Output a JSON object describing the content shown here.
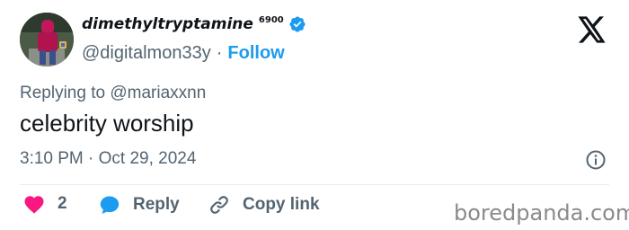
{
  "header": {
    "display_name": "dimethyltryptamine",
    "name_badge": "6900",
    "handle": "@digitalmon33y",
    "separator": "·",
    "follow_label": "Follow"
  },
  "reply_context": {
    "prefix": "Replying to",
    "mention": "@mariaxxnn"
  },
  "tweet": {
    "text": "celebrity worship",
    "timestamp": "3:10 PM · Oct 29, 2024"
  },
  "actions": {
    "like_count": "2",
    "reply_label": "Reply",
    "copy_link_label": "Copy link"
  },
  "watermark": "boredpanda.com",
  "colors": {
    "accent": "#1d9bf0",
    "like": "#f91880",
    "text_primary": "#0f1419",
    "text_secondary": "#536471"
  },
  "icons": [
    "x-logo-icon",
    "verified-badge-icon",
    "info-icon",
    "heart-icon",
    "reply-bubble-icon",
    "link-icon"
  ]
}
